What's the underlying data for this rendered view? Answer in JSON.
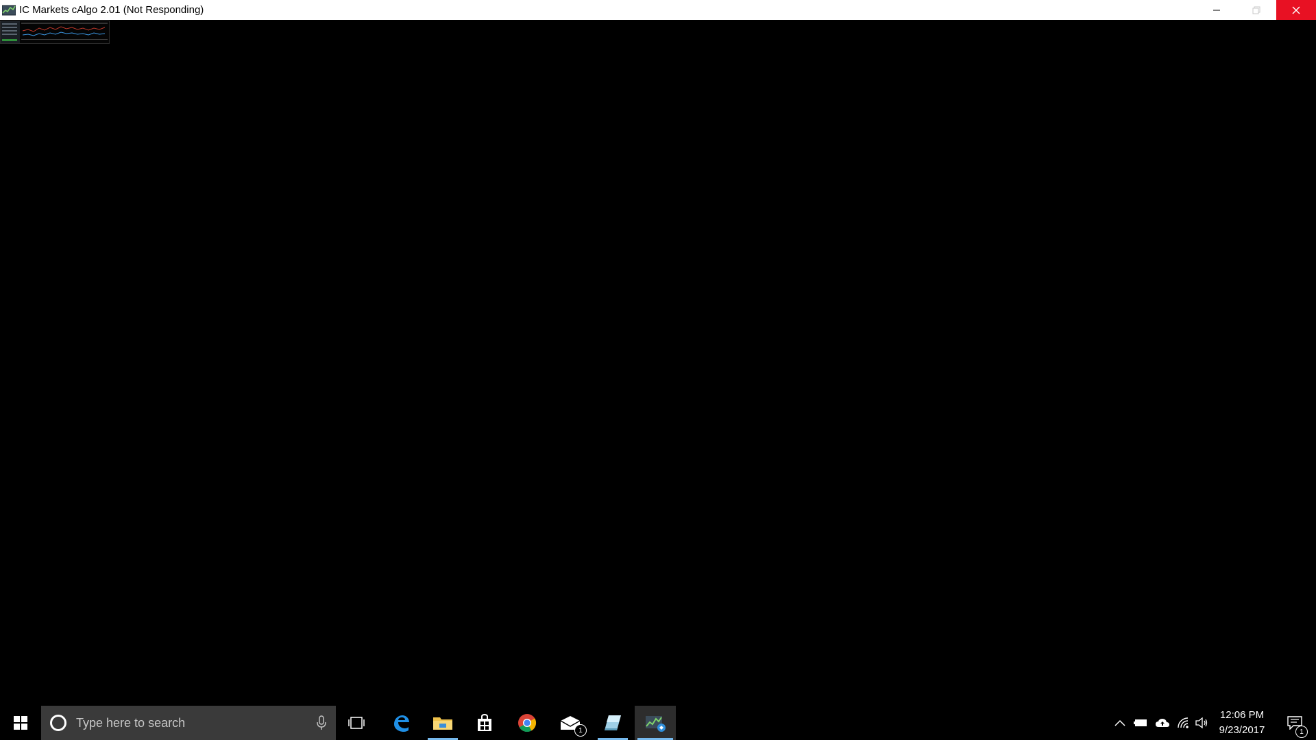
{
  "window": {
    "title": "IC Markets cAlgo 2.01 (Not Responding)",
    "controls": [
      "minimize",
      "maximize",
      "close"
    ]
  },
  "taskbar": {
    "search_placeholder": "Type here to search",
    "pinned": [
      {
        "name": "task-view",
        "icon": "task-view-icon"
      },
      {
        "name": "edge",
        "icon": "edge-icon"
      },
      {
        "name": "file-explorer",
        "icon": "folder-icon",
        "running": true
      },
      {
        "name": "store",
        "icon": "store-icon"
      },
      {
        "name": "chrome",
        "icon": "chrome-icon"
      },
      {
        "name": "mail",
        "icon": "mail-icon",
        "badge": "1"
      },
      {
        "name": "app",
        "icon": "crystal-icon",
        "running": true
      },
      {
        "name": "calgo",
        "icon": "calgo-icon",
        "running": true,
        "active": true
      }
    ],
    "tray": {
      "time": "12:06 PM",
      "date": "9/23/2017",
      "notification_badge": "1"
    }
  },
  "colors": {
    "close_button": "#e81123",
    "taskbar": "#000000",
    "search_box": "#3a3a3a",
    "running_indicator": "#76b9ed"
  }
}
